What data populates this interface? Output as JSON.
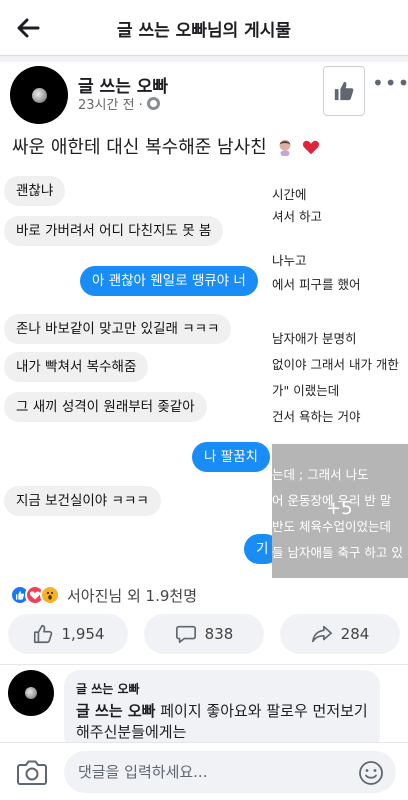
{
  "header": {
    "title": "글 쓰는 오빠님의 게시물"
  },
  "post": {
    "author": "글 쓰는 오빠",
    "time": "23시간 전 ·",
    "caption": "싸운 애한테 대신 복수해준 남사친"
  },
  "chat": {
    "messages": [
      {
        "dir": "in",
        "text": "괜찮냐"
      },
      {
        "dir": "in",
        "text": "바로 가버려서 어디 다친지도 못 봄"
      },
      {
        "dir": "out",
        "text": "아 괜찮아 웬일로 땡큐야 너"
      },
      {
        "dir": "in",
        "text": "존나 바보같이 맞고만 있길래 ㅋㅋㅋ"
      },
      {
        "dir": "in",
        "text": "내가 빡쳐서 복수해줌"
      },
      {
        "dir": "in",
        "text": "그 새끼 성격이 원래부터 좆같아"
      },
      {
        "dir": "out",
        "text": "나 팔꿈치"
      },
      {
        "dir": "in",
        "text": "지금 보건실이야 ㅋㅋㅋ"
      },
      {
        "dir": "out",
        "text": "기"
      }
    ],
    "thumb_lines": [
      "시간에",
      "셔서 하고",
      "나누고",
      "에서 피구를 했어",
      "남자애가 분명히",
      "없이야 그래서 내가 개한",
      "가\" 이랬는데",
      "건서 욕하는 거야",
      "는데 ; 그래서 나도",
      "어 운동장에 우리 반 말",
      "반도 체육수업이었는데",
      "들 남자애들 축구 하고 있"
    ],
    "more_count": "+5"
  },
  "reactions": {
    "summary": "서아진님 외 1.9천명"
  },
  "actions": {
    "likes": "1,954",
    "comments": "838",
    "shares": "284"
  },
  "comment": {
    "name": "글 쓰는 오빠",
    "body_bold": "글 쓰는 오빠",
    "body_text": " 페이지 좋아요와 팔로우 먼저보기 해주신분들에게는"
  },
  "input": {
    "placeholder": "댓글을 입력하세요..."
  },
  "colors": {
    "accent": "#1877f2",
    "chat_bubble": "#1a8cf5",
    "love": "#f33e58",
    "wow": "#f7b125"
  }
}
